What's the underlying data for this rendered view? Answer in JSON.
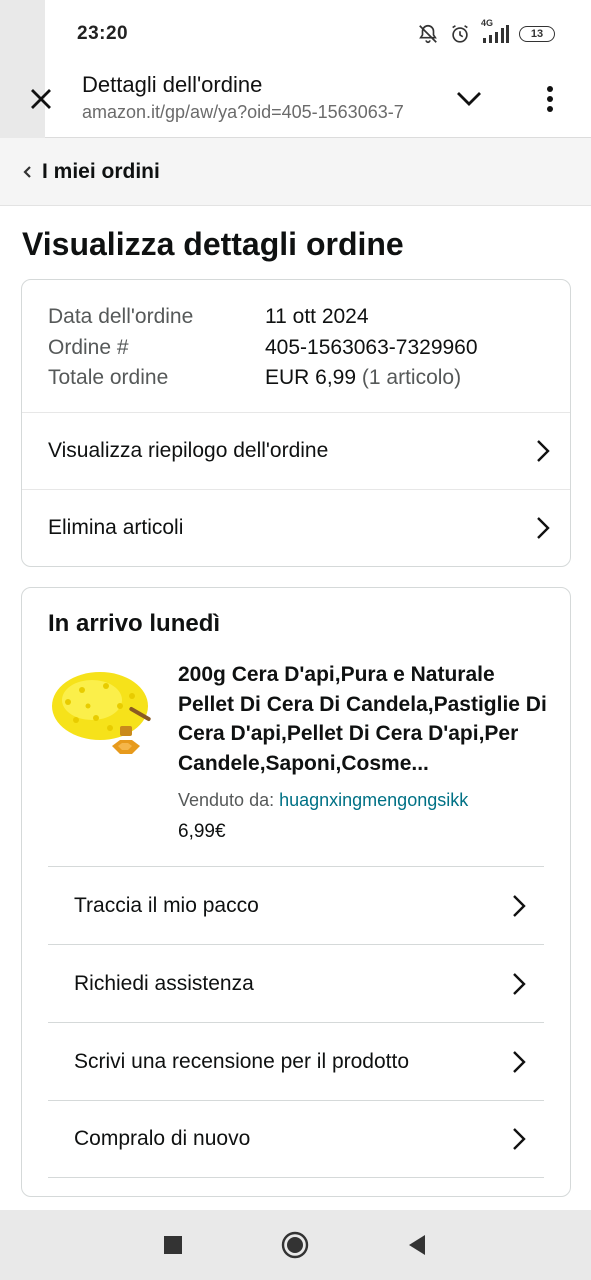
{
  "status_bar": {
    "time": "23:20",
    "network": "4G",
    "battery": "13",
    "icons": [
      "bell-off-icon",
      "alarm-icon",
      "signal-icon",
      "battery-icon"
    ]
  },
  "browser": {
    "title": "Dettagli dell'ordine",
    "url": "amazon.it/gp/aw/ya?oid=405-1563063-7",
    "icons": [
      "close-icon",
      "chevron-down-icon",
      "more-vert-icon"
    ]
  },
  "breadcrumb": {
    "label": "I miei ordini"
  },
  "heading": "Visualizza dettagli ordine",
  "order": {
    "date_label": "Data dell'ordine",
    "date_value": "11 ott 2024",
    "number_label": "Ordine #",
    "number_value": "405-1563063-7329960",
    "total_label": "Totale ordine",
    "total_value": "EUR 6,99",
    "total_items": "(1 articolo)",
    "links": [
      "Visualizza riepilogo dell'ordine",
      "Elimina articoli"
    ]
  },
  "shipment": {
    "title": "In arrivo lunedì",
    "product_title": "200g Cera D'api,Pura e Naturale Pellet Di Cera Di Candela,Pastiglie Di Cera D'api,Pellet Di Cera D'api,Per Candele,Saponi,Cosme...",
    "seller_label": "Venduto da: ",
    "seller_name": "huagnxingmengongsikk",
    "price": "6,99€",
    "actions": [
      "Traccia il mio pacco",
      "Richiedi assistenza",
      "Scrivi una recensione per il prodotto",
      "Compralo di nuovo"
    ]
  },
  "nav": {
    "icons": [
      "recents-icon",
      "home-icon",
      "back-icon"
    ]
  },
  "colors": {
    "link": "#007185",
    "text": "#0f1111",
    "muted": "#565959",
    "border": "#d5d9d9"
  }
}
